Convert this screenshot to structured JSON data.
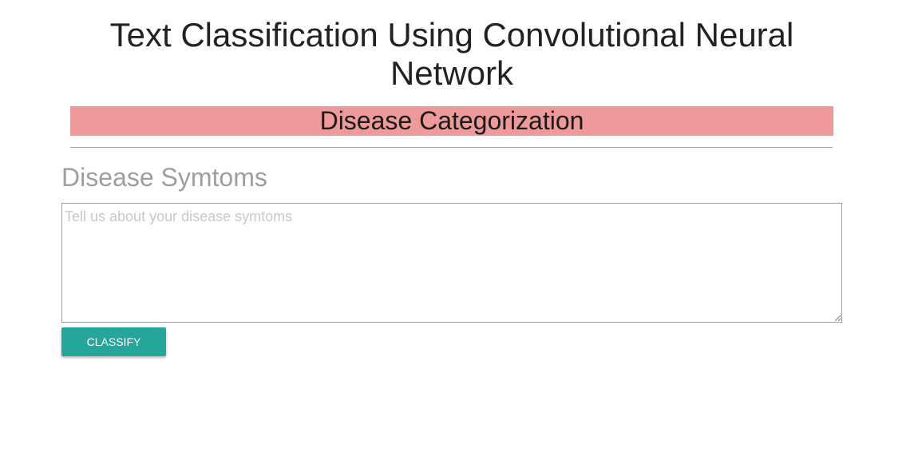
{
  "header": {
    "title": "Text Classification Using Convolutional Neural Network"
  },
  "banner": {
    "text": "Disease Categorization"
  },
  "form": {
    "label": "Disease Symtoms",
    "placeholder": "Tell us about your disease symtoms",
    "value": "",
    "button_label": "CLASSIFY"
  },
  "colors": {
    "banner": "#ef9a9a",
    "button": "#26a69a"
  }
}
